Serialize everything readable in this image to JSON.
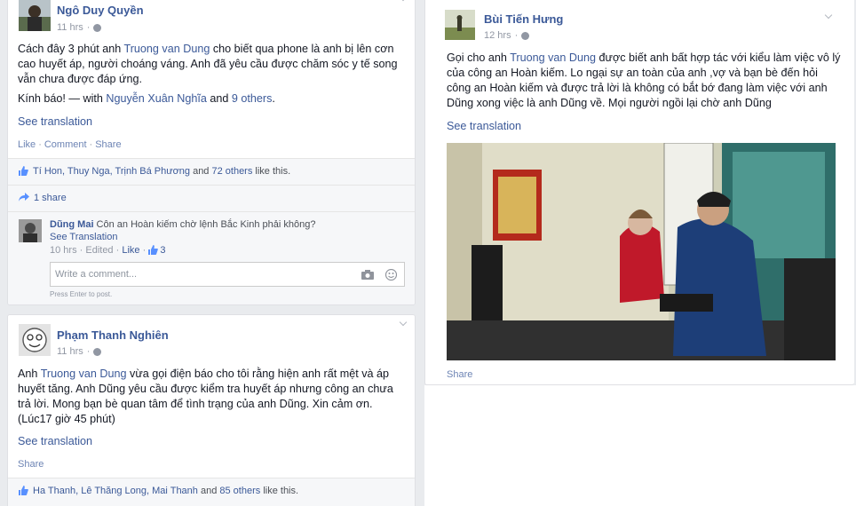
{
  "posts": [
    {
      "author": "Ngô Duy Quyền",
      "time": "11 hrs",
      "text_prefix": "Cách đây 3 phút anh ",
      "mention": "Truong van Dung",
      "text_suffix": " cho biết qua phone là anh bị lên cơn cao huyết áp, người choáng váng. Anh đã yêu cầu được chăm sóc y tế song vẫn chưa được đáp ứng.",
      "line2_prefix": "Kính báo! — with ",
      "with_name": "Nguyễn Xuân Nghĩa",
      "with_and": " and ",
      "with_others": "9 others",
      "with_end": ".",
      "see_translation": "See translation",
      "actions": [
        "Like",
        "Comment",
        "Share"
      ],
      "likes": {
        "names": "Tí Hon, Thuy Nga, Trịnh Bá Phương",
        "and": " and ",
        "others": "72 others",
        "suffix": " like this."
      },
      "shares": "1 share",
      "comment": {
        "author": "Dũng Mai",
        "text": " Côn an Hoàn kiếm chờ lệnh Bắc Kinh phải không?",
        "see_translation": "See Translation",
        "time": "10 hrs",
        "edited": "Edited",
        "like": "Like",
        "like_count": "3"
      },
      "comment_placeholder": "Write a comment...",
      "press_enter": "Press Enter to post."
    },
    {
      "author": "Phạm Thanh Nghiên",
      "time": "11 hrs",
      "text_prefix": "Anh ",
      "mention": "Truong van Dung",
      "text_suffix": " vừa gọi điện báo cho tôi rằng hiện anh rất mệt và áp huyết tăng. Anh Dũng yêu cầu được kiểm tra huyết áp nhưng công an chưa trả lời. Mong bạn bè quan tâm để tình trạng của anh Dũng. Xin cảm ơn. (Lúc17 giờ 45 phút)",
      "see_translation": "See translation",
      "actions": [
        "Share"
      ],
      "likes": {
        "names": "Ha Thanh, Lê Thăng Long, Mai Thanh",
        "and": " and ",
        "others": "85 others",
        "suffix": " like this."
      }
    },
    {
      "author": "Bùi Tiến Hưng",
      "time": "12 hrs",
      "text_prefix": "Gọi cho anh ",
      "mention": "Truong van Dung",
      "text_suffix": " được biết anh bất hợp tác với kiểu làm việc vô lý của công an Hoàn kiếm. Lo ngại sự an toàn của anh ,vợ và bạn bè đến hỏi công an Hoàn kiếm và được trả lời là không có bắt bớ đang làm việc với anh Dũng xong việc là anh Dũng về. Mọi người ngồi lại chờ anh Dũng",
      "see_translation": "See translation",
      "actions": [
        "Share"
      ]
    }
  ],
  "colors": {
    "link": "#3b5998",
    "background": "#e9ebee",
    "meta": "#9197a3"
  },
  "icons": [
    "globe-icon",
    "chevron-down-icon",
    "like-icon",
    "share-icon",
    "camera-icon",
    "emoji-icon"
  ]
}
